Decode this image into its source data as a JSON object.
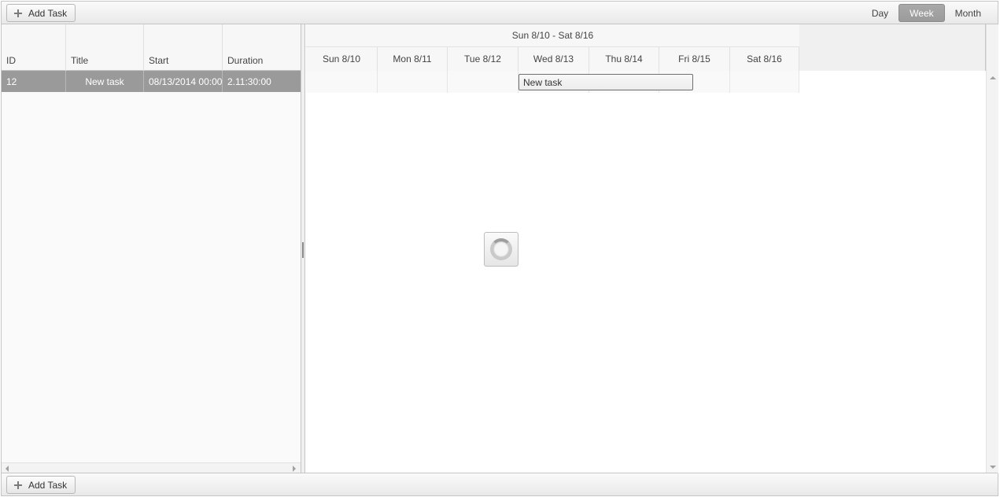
{
  "toolbar": {
    "add_task_label": "Add Task",
    "views": [
      {
        "label": "Day",
        "active": false
      },
      {
        "label": "Week",
        "active": true
      },
      {
        "label": "Month",
        "active": false
      }
    ]
  },
  "grid": {
    "columns": [
      "ID",
      "Title",
      "Start",
      "Duration"
    ],
    "rows": [
      {
        "id": "12",
        "title": "New task",
        "start": "08/13/2014 00:00",
        "duration": "2.11:30:00"
      }
    ]
  },
  "timeline": {
    "week_label": "Sun 8/10 - Sat 8/16",
    "days": [
      "Sun 8/10",
      "Mon 8/11",
      "Tue 8/12",
      "Wed 8/13",
      "Thu 8/14",
      "Fri 8/15",
      "Sat 8/16"
    ],
    "task_bar_label": "New task"
  },
  "footer": {
    "add_task_label": "Add Task"
  },
  "colors": {
    "selected_row": "#9a9a9a",
    "active_view": "#a3a3a3",
    "border": "#c5c5c5"
  },
  "icons": {
    "add": "plus-icon",
    "loading": "loading-spinner-icon",
    "scroll_left": "scroll-left-arrow-icon",
    "scroll_right": "scroll-right-arrow-icon",
    "scroll_up": "scroll-up-arrow-icon",
    "scroll_down": "scroll-down-arrow-icon"
  }
}
